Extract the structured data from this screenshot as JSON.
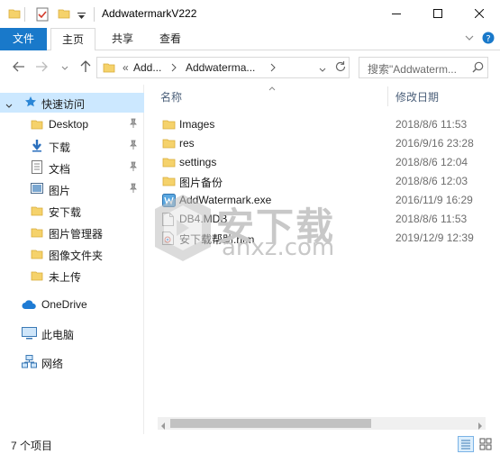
{
  "window": {
    "title": "AddwatermarkV222",
    "minimize_icon": "minimize-icon",
    "maximize_icon": "maximize-icon",
    "close_icon": "close-icon"
  },
  "ribbon": {
    "tabs": [
      {
        "label": "文件"
      },
      {
        "label": "主页"
      },
      {
        "label": "共享"
      },
      {
        "label": "查看"
      }
    ]
  },
  "address": {
    "prefix": "«",
    "segments": [
      "Add...",
      "Addwaterma..."
    ]
  },
  "search": {
    "placeholder": "搜索\"Addwaterm..."
  },
  "navpane": {
    "quick_access": "快速访问",
    "items": [
      {
        "label": "Desktop",
        "pinned": true
      },
      {
        "label": "下载",
        "pinned": true
      },
      {
        "label": "文档",
        "pinned": true
      },
      {
        "label": "图片",
        "pinned": true
      },
      {
        "label": "安下载",
        "pinned": false
      },
      {
        "label": "图片管理器",
        "pinned": false
      },
      {
        "label": "图像文件夹",
        "pinned": false
      },
      {
        "label": "未上传",
        "pinned": false
      }
    ],
    "onedrive": "OneDrive",
    "this_pc": "此电脑",
    "network": "网络"
  },
  "content": {
    "columns": {
      "name": "名称",
      "modified": "修改日期"
    },
    "rows": [
      {
        "name": "Images",
        "date": "2018/8/6 11:53",
        "icon": "folder-icon"
      },
      {
        "name": "res",
        "date": "2016/9/16 23:28",
        "icon": "folder-icon"
      },
      {
        "name": "settings",
        "date": "2018/8/6 12:04",
        "icon": "folder-icon"
      },
      {
        "name": "图片备份",
        "date": "2018/8/6 12:03",
        "icon": "folder-icon"
      },
      {
        "name": "AddWatermark.exe",
        "date": "2016/11/9 16:29",
        "icon": "exe-icon"
      },
      {
        "name": "DB4.MDB",
        "date": "2018/8/6 11:53",
        "icon": "database-file-icon"
      },
      {
        "name": "安下载帮助.htm",
        "date": "2019/12/9 12:39",
        "icon": "html-file-icon"
      }
    ]
  },
  "watermark": {
    "text": "安下载",
    "sub": "anxz.com"
  },
  "status": {
    "count": "7 个项目"
  }
}
